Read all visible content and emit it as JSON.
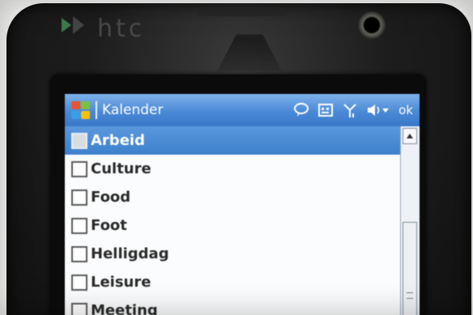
{
  "device": {
    "brand": "htc"
  },
  "titlebar": {
    "app_title": "Kalender",
    "ok_label": "ok"
  },
  "categories": {
    "items": [
      {
        "label": "Arbeid",
        "selected": true,
        "checked": false
      },
      {
        "label": "Culture",
        "selected": false,
        "checked": false
      },
      {
        "label": "Food",
        "selected": false,
        "checked": false
      },
      {
        "label": "Foot",
        "selected": false,
        "checked": false
      },
      {
        "label": "Helligdag",
        "selected": false,
        "checked": false
      },
      {
        "label": "Leisure",
        "selected": false,
        "checked": false
      },
      {
        "label": "Meeting",
        "selected": false,
        "checked": false
      }
    ]
  },
  "icons": {
    "start": "windows-start-icon",
    "tray": [
      "messaging-icon",
      "keyboard-icon",
      "signal-icon",
      "volume-icon"
    ]
  },
  "colors": {
    "titlebar": "#4a89d6",
    "selection": "#3d80cc"
  }
}
